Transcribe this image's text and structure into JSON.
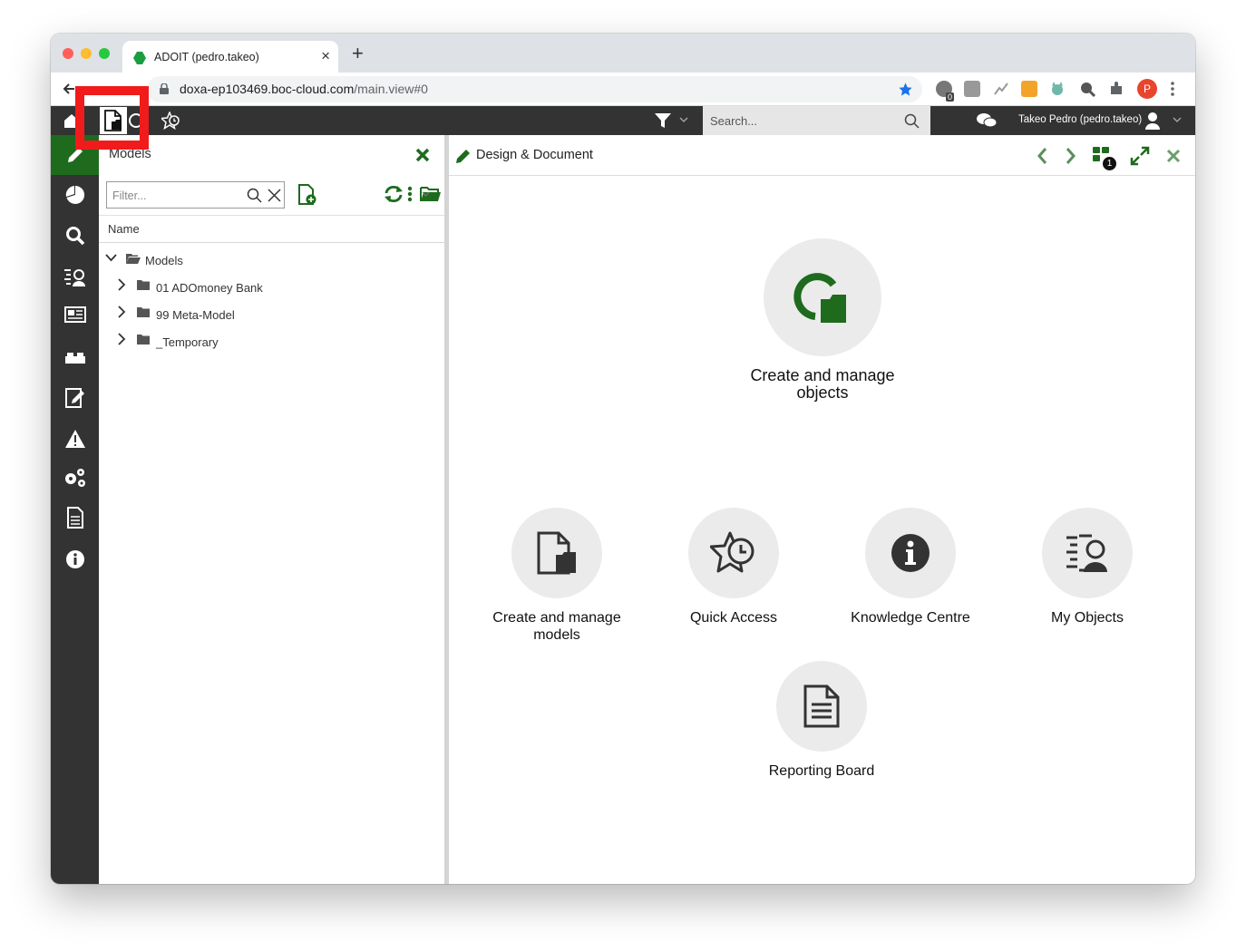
{
  "browser": {
    "tab_title": "ADOIT (pedro.takeo)",
    "tab_close": "×",
    "new_tab": "+",
    "url_host": "doxa-ep103469.boc-cloud.com",
    "url_path": "/main.view#0",
    "ext_badge": "0",
    "profile_initial": "P"
  },
  "header": {
    "search_placeholder": "Search...",
    "user_label": "Takeo Pedro (pedro.takeo)"
  },
  "models_panel": {
    "title": "Models",
    "filter_placeholder": "Filter...",
    "column_name": "Name",
    "tree": [
      {
        "label": "Models",
        "level": 0,
        "expanded": true
      },
      {
        "label": "01 ADOmoney Bank",
        "level": 1,
        "expanded": false
      },
      {
        "label": "99 Meta-Model",
        "level": 1,
        "expanded": false
      },
      {
        "label": "_Temporary",
        "level": 1,
        "expanded": false
      }
    ]
  },
  "main": {
    "title": "Design & Document",
    "badge_count": "1",
    "tiles": {
      "objects": "Create and manage objects",
      "models_line1": "Create and manage",
      "models_line2": "models",
      "quick_access": "Quick Access",
      "knowledge": "Knowledge Centre",
      "my_objects": "My Objects",
      "reporting": "Reporting Board"
    }
  },
  "colors": {
    "brand_green": "#1e6b1e",
    "dark_bar": "#333333",
    "highlight_red": "#f21b1b"
  }
}
